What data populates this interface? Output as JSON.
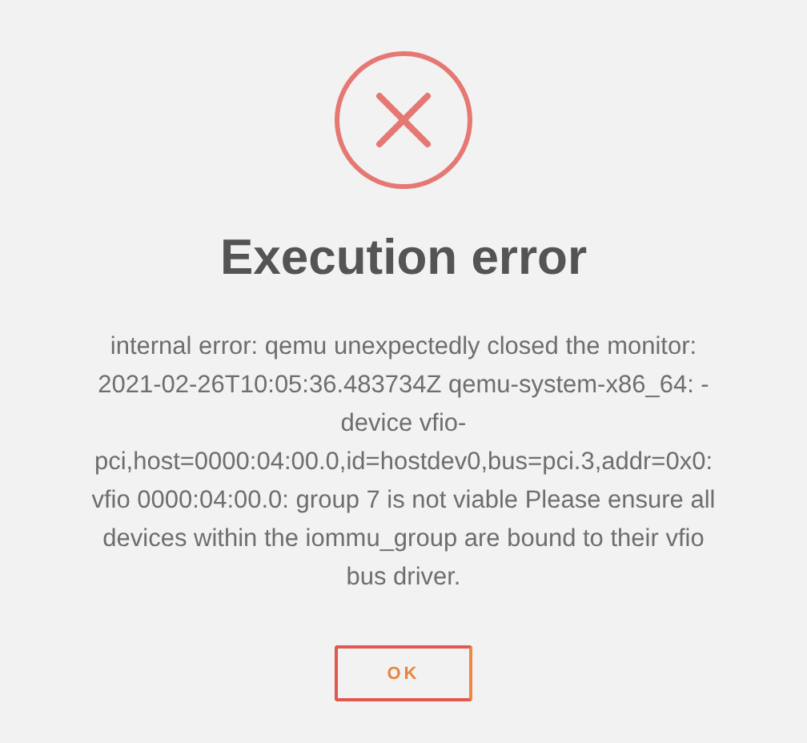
{
  "dialog": {
    "title": "Execution error",
    "message_lines": [
      "internal error: qemu unexpectedly closed the monitor:",
      "2021-02-26T10:05:36.483734Z qemu-system-x86_64: -",
      "device vfio-",
      "pci,host=0000:04:00.0,id=hostdev0,bus=pci.3,addr=0x0:",
      "vfio 0000:04:00.0: group 7 is not viable Please ensure all",
      "devices within the iommu_group are bound to their vfio",
      "bus driver."
    ],
    "buttons": [
      "OK"
    ]
  }
}
